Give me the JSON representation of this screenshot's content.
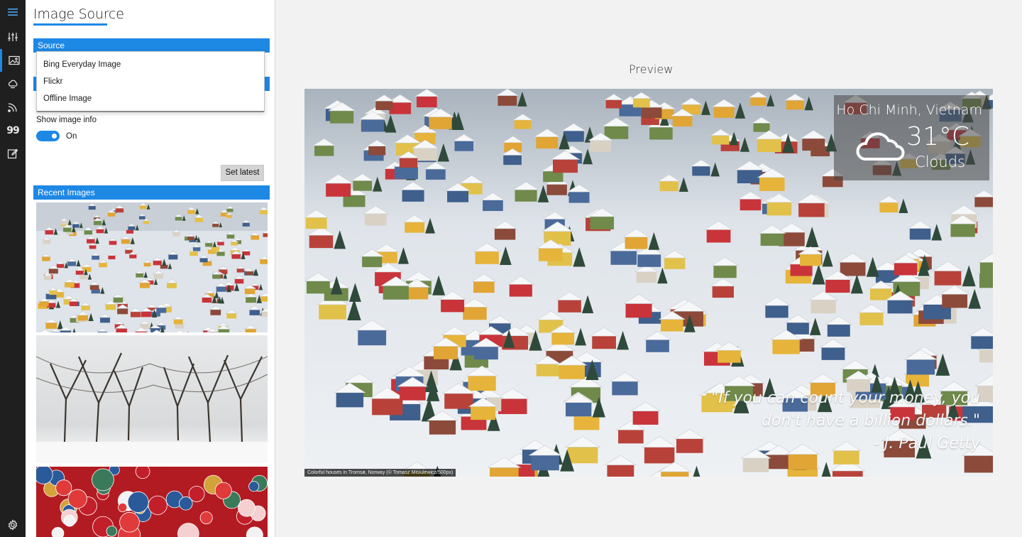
{
  "rail": {
    "items": [
      {
        "icon": "hamburger-menu-icon"
      },
      {
        "icon": "equalizer-sliders-icon"
      },
      {
        "icon": "image-icon",
        "active": true
      },
      {
        "icon": "weather-icon"
      },
      {
        "icon": "rss-feed-icon"
      },
      {
        "icon": "quote-icon",
        "glyph": "99"
      },
      {
        "icon": "edit-note-icon"
      },
      {
        "icon": "settings-gear-icon"
      }
    ],
    "accent_color": "#1e88e5"
  },
  "pane": {
    "title": "Image Source",
    "source_section": "Source",
    "source_options": [
      "Bing Everyday Image",
      "Flickr",
      "Offline Image"
    ],
    "show_info_label": "Show image info",
    "show_info_toggle": {
      "state": "On",
      "enabled": true
    },
    "set_latest_label": "Set latest",
    "recent_section": "Recent Images",
    "recent_images": [
      {
        "icon": "snowy-village-thumbnail"
      },
      {
        "icon": "snowy-trees-thumbnail"
      },
      {
        "icon": "christmas-ornaments-thumbnail"
      }
    ]
  },
  "preview": {
    "label": "Preview",
    "weather": {
      "location": "Ho Chi Minh, Vietnam",
      "temperature": "31°C",
      "condition": "Clouds",
      "icon": "cloud-icon"
    },
    "quote": {
      "text": "\"If you can count your money, you don't have a billion dollars.\"",
      "author": "- J. Paul Getty"
    },
    "caption": "Colorful houses in Tromsø, Norway (© Tomasz Misiulewicz/500px)"
  }
}
